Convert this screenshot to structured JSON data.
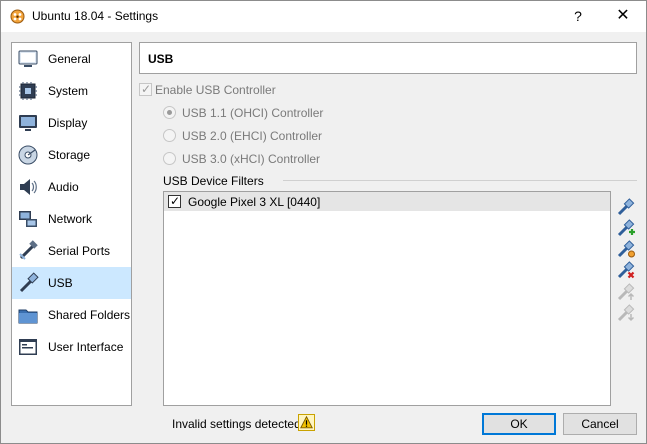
{
  "window": {
    "title": "Ubuntu 18.04 - Settings",
    "help_label": "?",
    "close_label": "✕"
  },
  "sidebar": {
    "items": [
      {
        "label": "General",
        "icon": "general-icon",
        "selected": false
      },
      {
        "label": "System",
        "icon": "system-icon",
        "selected": false
      },
      {
        "label": "Display",
        "icon": "display-icon",
        "selected": false
      },
      {
        "label": "Storage",
        "icon": "storage-icon",
        "selected": false
      },
      {
        "label": "Audio",
        "icon": "audio-icon",
        "selected": false
      },
      {
        "label": "Network",
        "icon": "network-icon",
        "selected": false
      },
      {
        "label": "Serial Ports",
        "icon": "serial-ports-icon",
        "selected": false
      },
      {
        "label": "USB",
        "icon": "usb-icon",
        "selected": true
      },
      {
        "label": "Shared Folders",
        "icon": "shared-folders-icon",
        "selected": false
      },
      {
        "label": "User Interface",
        "icon": "user-interface-icon",
        "selected": false
      }
    ]
  },
  "page": {
    "title": "USB",
    "enable_usb": {
      "label": "Enable USB Controller",
      "checked": true,
      "enabled": false
    },
    "controllers": [
      {
        "label": "USB 1.1 (OHCI) Controller",
        "selected": true
      },
      {
        "label": "USB 2.0 (EHCI) Controller",
        "selected": false
      },
      {
        "label": "USB 3.0 (xHCI) Controller",
        "selected": false
      }
    ],
    "filters": {
      "title": "USB Device Filters",
      "items": [
        {
          "label": "Google Pixel 3 XL [0440]",
          "checked": true
        }
      ],
      "tools": [
        {
          "name": "add-filter-icon",
          "enabled": true
        },
        {
          "name": "add-from-device-icon",
          "enabled": true
        },
        {
          "name": "edit-filter-icon",
          "enabled": true
        },
        {
          "name": "remove-filter-icon",
          "enabled": true
        },
        {
          "name": "move-up-icon",
          "enabled": false
        },
        {
          "name": "move-down-icon",
          "enabled": false
        }
      ]
    }
  },
  "footer": {
    "status": "Invalid settings detected",
    "warning_icon": "warning-icon",
    "ok_label": "OK",
    "cancel_label": "Cancel"
  },
  "colors": {
    "selection": "#cce8ff",
    "accent": "#0078d7",
    "warning": "#f2c200"
  }
}
